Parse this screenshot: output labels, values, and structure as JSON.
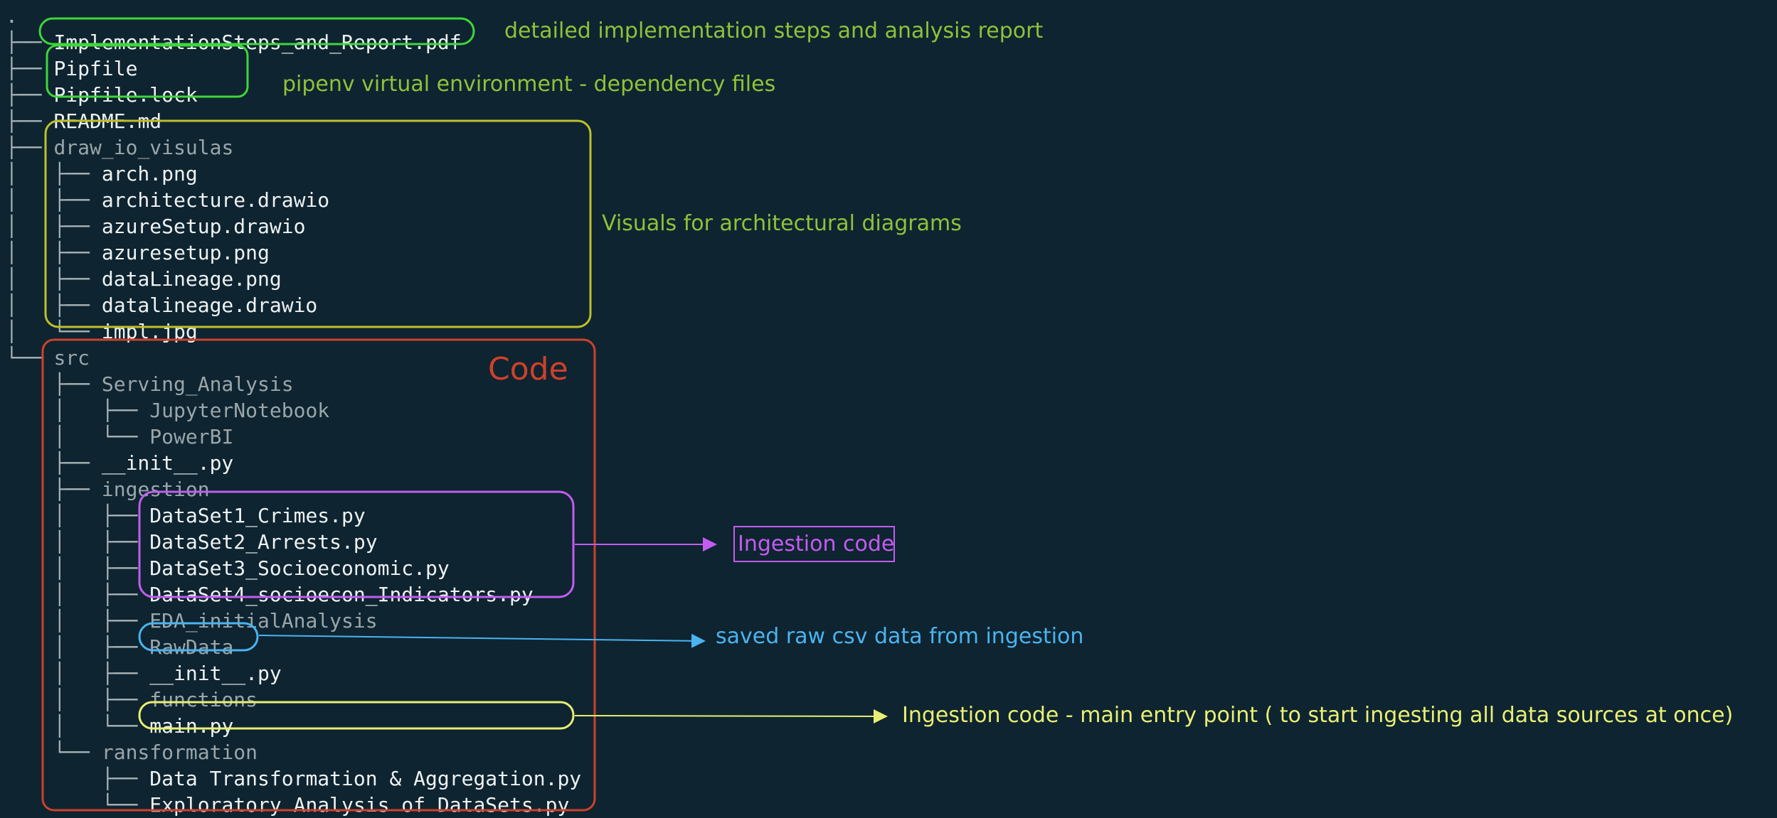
{
  "tree": [
    {
      "prefix": ".",
      "name": "",
      "dir": true
    },
    {
      "prefix": "├── ",
      "name": "ImplementationSteps_and_Report.pdf",
      "dir": false
    },
    {
      "prefix": "├── ",
      "name": "Pipfile",
      "dir": false
    },
    {
      "prefix": "├── ",
      "name": "Pipfile.lock",
      "dir": false
    },
    {
      "prefix": "├── ",
      "name": "README.md",
      "dir": false
    },
    {
      "prefix": "├── ",
      "name": "draw_io_visulas",
      "dir": true
    },
    {
      "prefix": "│   ├── ",
      "name": "arch.png",
      "dir": false
    },
    {
      "prefix": "│   ├── ",
      "name": "architecture.drawio",
      "dir": false
    },
    {
      "prefix": "│   ├── ",
      "name": "azureSetup.drawio",
      "dir": false
    },
    {
      "prefix": "│   ├── ",
      "name": "azuresetup.png",
      "dir": false
    },
    {
      "prefix": "│   ├── ",
      "name": "dataLineage.png",
      "dir": false
    },
    {
      "prefix": "│   ├── ",
      "name": "datalineage.drawio",
      "dir": false
    },
    {
      "prefix": "│   └── ",
      "name": "impl.jpg",
      "dir": false
    },
    {
      "prefix": "└── ",
      "name": "src",
      "dir": true
    },
    {
      "prefix": "    ├── ",
      "name": "Serving_Analysis",
      "dir": true
    },
    {
      "prefix": "    │   ├── ",
      "name": "JupyterNotebook",
      "dir": true
    },
    {
      "prefix": "    │   └── ",
      "name": "PowerBI",
      "dir": true
    },
    {
      "prefix": "    ├── ",
      "name": "__init__.py",
      "dir": false
    },
    {
      "prefix": "    ├── ",
      "name": "ingestion",
      "dir": true
    },
    {
      "prefix": "    │   ├── ",
      "name": "DataSet1_Crimes.py",
      "dir": false
    },
    {
      "prefix": "    │   ├── ",
      "name": "DataSet2_Arrests.py",
      "dir": false
    },
    {
      "prefix": "    │   ├── ",
      "name": "DataSet3_Socioeconomic.py",
      "dir": false
    },
    {
      "prefix": "    │   ├── ",
      "name": "DataSet4_socioecon_Indicators.py",
      "dir": false
    },
    {
      "prefix": "    │   ├── ",
      "name": "EDA_initialAnalysis",
      "dir": true
    },
    {
      "prefix": "    │   ├── ",
      "name": "RawData",
      "dir": true
    },
    {
      "prefix": "    │   ├── ",
      "name": "__init__.py",
      "dir": false
    },
    {
      "prefix": "    │   ├── ",
      "name": "functions",
      "dir": true
    },
    {
      "prefix": "    │   └── ",
      "name": "main.py",
      "dir": false
    },
    {
      "prefix": "    └── ",
      "name": "ransformation",
      "dir": true
    },
    {
      "prefix": "        ├── ",
      "name": "Data Transformation & Aggregation.py",
      "dir": false
    },
    {
      "prefix": "        └── ",
      "name": "Exploratory Analysis of DataSets.py",
      "dir": false
    }
  ],
  "annotations": {
    "report": "detailed implementation steps and analysis report",
    "pipenv": "pipenv virtual environment - dependency files",
    "visuals": "Visuals for architectural diagrams",
    "code": "Code",
    "ingestion_code": "Ingestion code",
    "raw_data": "saved raw csv data from ingestion",
    "main_entry": "Ingestion code - main entry point ( to start ingesting all data sources at once)"
  },
  "colors": {
    "background": "#0e2430",
    "green": "#3fd63a",
    "green_text": "#8fc23a",
    "olive": "#bfbf2a",
    "orange": "#d0402a",
    "purple": "#c35cf0",
    "blue": "#4ab4f0",
    "yellow": "#e9ef72"
  }
}
